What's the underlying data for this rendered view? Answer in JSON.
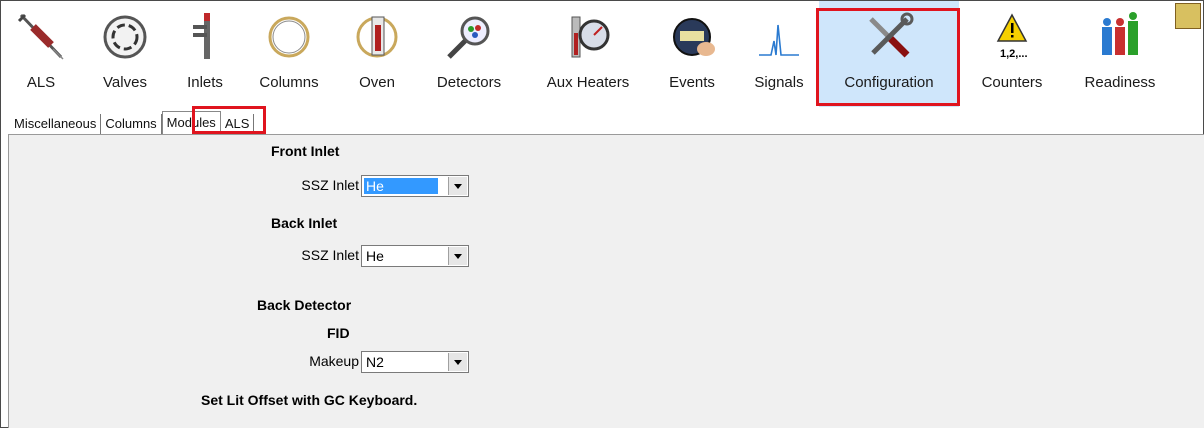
{
  "toolbar": {
    "items": [
      {
        "label": "ALS",
        "icon": "syringe-icon"
      },
      {
        "label": "Valves",
        "icon": "valve-icon"
      },
      {
        "label": "Inlets",
        "icon": "inlet-icon"
      },
      {
        "label": "Columns",
        "icon": "column-coil-icon"
      },
      {
        "label": "Oven",
        "icon": "oven-thermometer-icon"
      },
      {
        "label": "Detectors",
        "icon": "detector-magnifier-icon"
      },
      {
        "label": "Aux Heaters",
        "icon": "aux-heater-gauge-icon"
      },
      {
        "label": "Events",
        "icon": "stopwatch-icon"
      },
      {
        "label": "Signals",
        "icon": "signal-peak-icon"
      },
      {
        "label": "Configuration",
        "icon": "wrench-screwdriver-icon"
      },
      {
        "label": "Counters",
        "icon": "warning-counter-icon",
        "icon_text": "1,2,..."
      },
      {
        "label": "Readiness",
        "icon": "readiness-people-icon"
      }
    ],
    "active": "Configuration"
  },
  "tabs": [
    "Miscellaneous",
    "Columns",
    "Modules",
    "ALS"
  ],
  "active_tab": "Modules",
  "modules": {
    "front_inlet": {
      "heading": "Front Inlet",
      "label": "SSZ Inlet",
      "value": "He"
    },
    "back_inlet": {
      "heading": "Back Inlet",
      "label": "SSZ Inlet",
      "value": "He"
    },
    "back_detector": {
      "heading": "Back Detector",
      "type": "FID",
      "label": "Makeup",
      "value": "N2"
    },
    "note": "Set Lit Offset with GC Keyboard."
  },
  "colors": {
    "highlight": "#e0141e",
    "active_bg": "#cfe6fb",
    "selection": "#3399ff"
  }
}
